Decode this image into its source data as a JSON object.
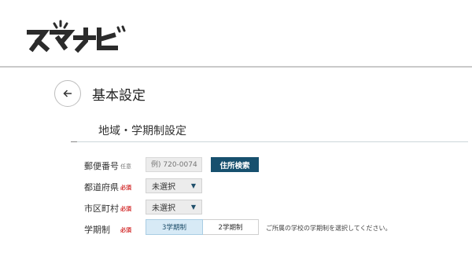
{
  "app": {
    "logo_text": "スマナビ",
    "brand_color": "#2b2b2b",
    "accent_color": "#17506e"
  },
  "header": {
    "back_icon": "arrow-left-icon",
    "title": "基本設定"
  },
  "section": {
    "title": "地域・学期制設定"
  },
  "form": {
    "postal": {
      "label": "郵便番号",
      "tag": "任意",
      "placeholder": "例) 720-0074",
      "button": "住所検索"
    },
    "prefecture": {
      "label": "都道府県",
      "tag": "必須",
      "value": "未選択"
    },
    "city": {
      "label": "市区町村",
      "tag": "必須",
      "value": "未選択"
    },
    "term": {
      "label": "学期制",
      "tag": "必須",
      "options": [
        "3学期制",
        "2学期制"
      ],
      "selected": "3学期制",
      "help": "ご所属の学校の学期制を選択してください。"
    }
  }
}
